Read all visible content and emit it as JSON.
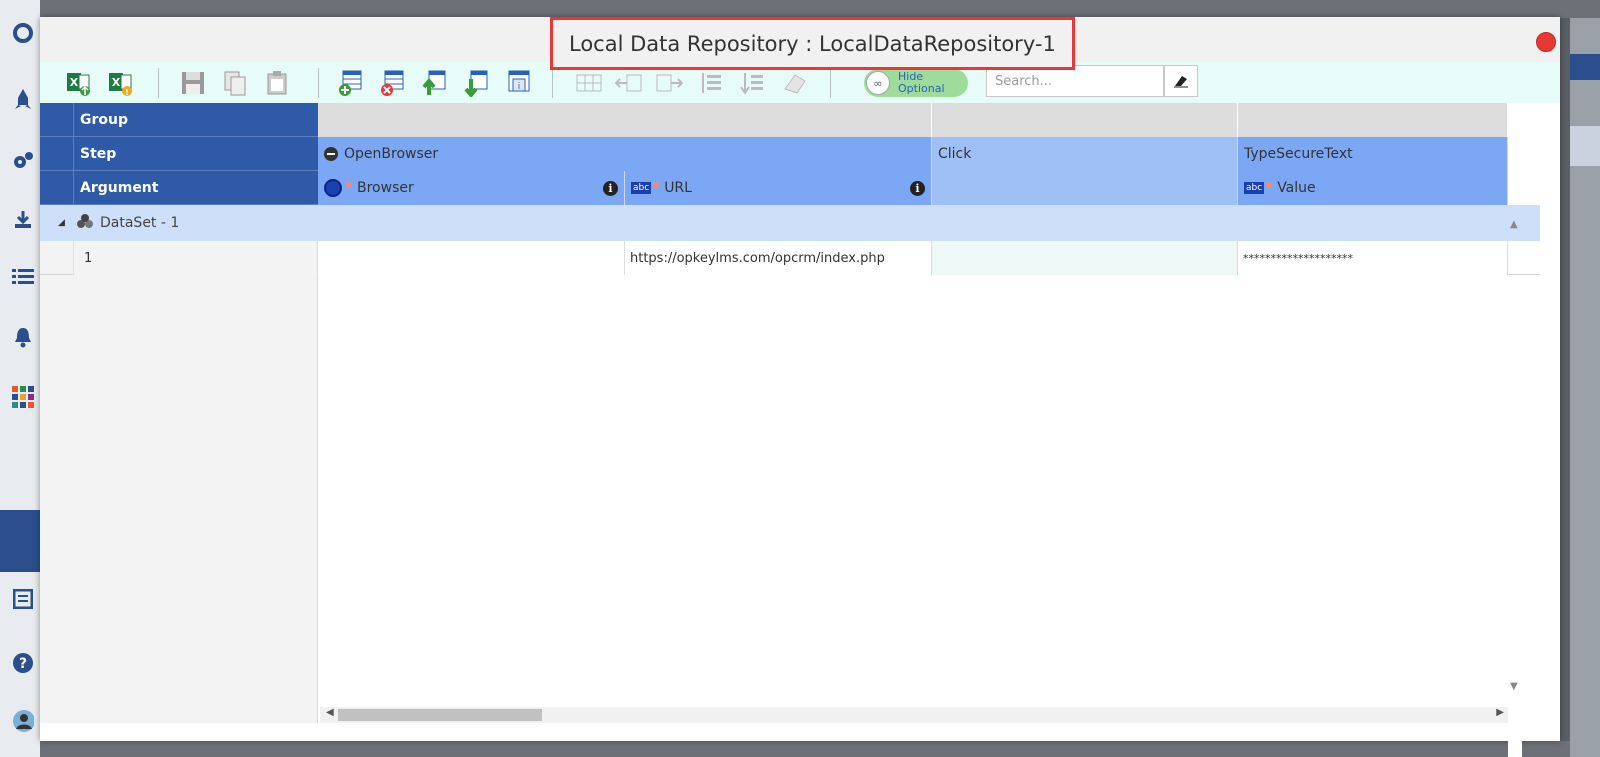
{
  "modal": {
    "title": "Local Data Repository : LocalDataRepository-1"
  },
  "toolbar": {
    "buttons": [
      "import-excel",
      "export-excel",
      "save",
      "copy",
      "paste",
      "add-dataset",
      "delete-dataset",
      "move-up",
      "move-down",
      "insert-dataset",
      "insert-row",
      "insert-left",
      "insert-right",
      "indent",
      "outdent",
      "erase"
    ],
    "toggle_label_line1": "Hide",
    "toggle_label_line2": "Optional",
    "search_placeholder": "Search..."
  },
  "grid": {
    "row_labels": {
      "group": "Group",
      "step": "Step",
      "argument": "Argument"
    },
    "steps": [
      {
        "name": "OpenBrowser"
      },
      {
        "name": "Click"
      },
      {
        "name": "TypeSecureText"
      }
    ],
    "arguments": [
      {
        "name": "Browser"
      },
      {
        "name": "URL"
      },
      {
        "name": ""
      },
      {
        "name": "Value"
      }
    ],
    "dataset_label": "DataSet - 1",
    "rows": [
      {
        "index": "1",
        "browser": "",
        "url": "https://opkeylms.com/opcrm/index.php",
        "click": "",
        "value": "********************"
      }
    ]
  },
  "colors": {
    "header_dark": "#2f5aa8",
    "header_mid": "#7ba7f5",
    "header_light": "#9fbff7",
    "dataset_row": "#cddff9",
    "toolbar_bg": "#e7fcf8",
    "title_highlight": "#e53935"
  }
}
